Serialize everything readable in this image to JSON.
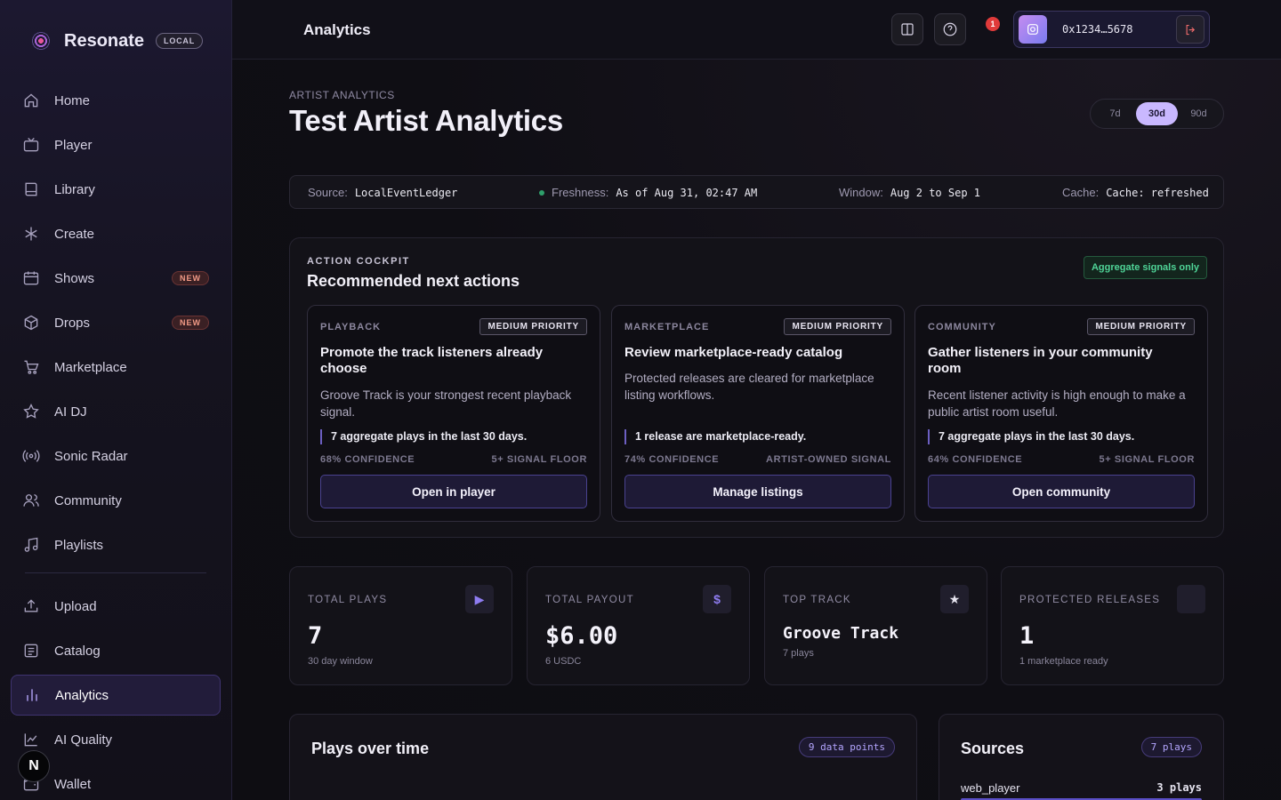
{
  "brand": {
    "name": "Resonate",
    "badge": "LOCAL"
  },
  "sidebar": {
    "items": [
      {
        "label": "Home",
        "icon": "home-icon"
      },
      {
        "label": "Player",
        "icon": "tv-icon"
      },
      {
        "label": "Library",
        "icon": "book-icon"
      },
      {
        "label": "Create",
        "icon": "asterisk-icon"
      },
      {
        "label": "Shows",
        "icon": "calendar-icon",
        "badge": "NEW"
      },
      {
        "label": "Drops",
        "icon": "box-icon",
        "badge": "NEW"
      },
      {
        "label": "Marketplace",
        "icon": "cart-icon"
      },
      {
        "label": "AI DJ",
        "icon": "star-icon"
      },
      {
        "label": "Sonic Radar",
        "icon": "radar-icon"
      },
      {
        "label": "Community",
        "icon": "users-icon"
      },
      {
        "label": "Playlists",
        "icon": "music-icon"
      }
    ],
    "secondary": [
      {
        "label": "Upload",
        "icon": "upload-icon"
      },
      {
        "label": "Catalog",
        "icon": "list-icon"
      },
      {
        "label": "Analytics",
        "icon": "bar-chart-icon",
        "active": true
      },
      {
        "label": "AI Quality",
        "icon": "line-chart-icon"
      },
      {
        "label": "Wallet",
        "icon": "wallet-icon"
      }
    ]
  },
  "floating_badge": "N",
  "topbar": {
    "title": "Analytics",
    "notification_count": "1",
    "wallet_address": "0x1234…5678"
  },
  "page": {
    "eyebrow": "ARTIST ANALYTICS",
    "title": "Test Artist Analytics"
  },
  "range": {
    "options": [
      "7d",
      "30d",
      "90d"
    ],
    "selected": "30d"
  },
  "meta": {
    "source_label": "Source:",
    "source": "LocalEventLedger",
    "freshness_label": "Freshness:",
    "freshness": "As of Aug 31, 02:47 AM",
    "window_label": "Window:",
    "window": "Aug 2 to Sep 1",
    "cache_label": "Cache:",
    "cache": "Cache: refreshed"
  },
  "cockpit": {
    "eyebrow": "ACTION COCKPIT",
    "title": "Recommended next actions",
    "badge": "Aggregate signals only",
    "cards": [
      {
        "category": "PLAYBACK",
        "priority": "MEDIUM PRIORITY",
        "title": "Promote the track listeners already choose",
        "description": "Groove Track is your strongest recent playback signal.",
        "stat": "7 aggregate plays in the last 30 days.",
        "confidence": "68% CONFIDENCE",
        "signal": "5+ SIGNAL FLOOR",
        "button": "Open in player"
      },
      {
        "category": "MARKETPLACE",
        "priority": "MEDIUM PRIORITY",
        "title": "Review marketplace-ready catalog",
        "description": "Protected releases are cleared for marketplace listing workflows.",
        "stat": "1 release are marketplace-ready.",
        "confidence": "74% CONFIDENCE",
        "signal": "ARTIST-OWNED SIGNAL",
        "button": "Manage listings"
      },
      {
        "category": "COMMUNITY",
        "priority": "MEDIUM PRIORITY",
        "title": "Gather listeners in your community room",
        "description": "Recent listener activity is high enough to make a public artist room useful.",
        "stat": "7 aggregate plays in the last 30 days.",
        "confidence": "64% CONFIDENCE",
        "signal": "5+ SIGNAL FLOOR",
        "button": "Open community"
      }
    ]
  },
  "kpis": [
    {
      "label": "TOTAL PLAYS",
      "value": "7",
      "sub": "30 day window",
      "icon": "play-icon",
      "glyph": "▶"
    },
    {
      "label": "TOTAL PAYOUT",
      "value": "$6.00",
      "sub": "6 USDC",
      "icon": "dollar-icon",
      "glyph": "$"
    },
    {
      "label": "TOP TRACK",
      "value": "Groove Track",
      "sub": "7 plays",
      "icon": "star-icon",
      "glyph": "★"
    },
    {
      "label": "PROTECTED RELEASES",
      "value": "1",
      "sub": "1 marketplace ready",
      "icon": "shield-icon",
      "glyph": ""
    }
  ],
  "plays_panel": {
    "title": "Plays over time",
    "pill": "9 data points"
  },
  "sources_panel": {
    "title": "Sources",
    "pill": "7 plays",
    "rows": [
      {
        "name": "web_player",
        "value": "3 plays",
        "fraction": 0.43
      }
    ]
  }
}
